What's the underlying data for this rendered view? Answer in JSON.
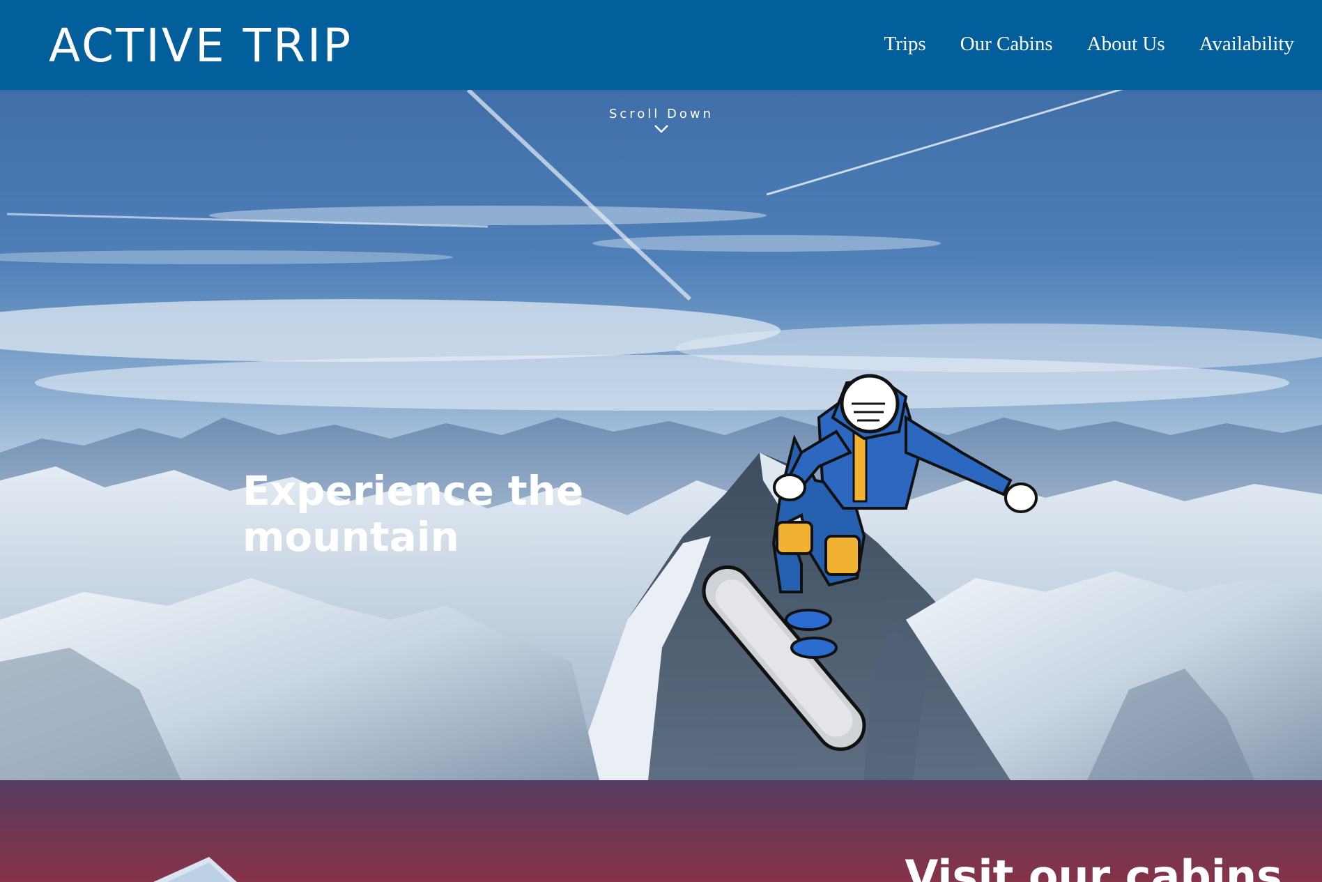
{
  "brand": {
    "name": "ACTIVE TRIP"
  },
  "nav": {
    "items": [
      {
        "label": "Trips"
      },
      {
        "label": "Our Cabins"
      },
      {
        "label": "About Us"
      },
      {
        "label": "Availability"
      }
    ]
  },
  "hero": {
    "scroll_label": "Scroll Down",
    "title": "Experience the mountain",
    "scroll_icon": "chevron-down-icon"
  },
  "cabins": {
    "title": "Visit our cabins"
  },
  "colors": {
    "header_bg": "#035e9c",
    "text": "#ffffff",
    "cabins_gradient_top": "#563b63",
    "cabins_gradient_bottom": "#86344a"
  }
}
